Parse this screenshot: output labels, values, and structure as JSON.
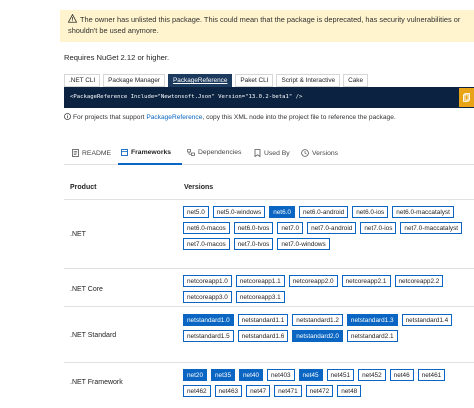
{
  "warning": {
    "text": "The owner has unlisted this package. This could mean that the package is deprecated, has security vulnerabilities or shouldn't be used anymore."
  },
  "requires": "Requires NuGet 2.12 or higher.",
  "install_tabs": [
    {
      "label": ".NET CLI",
      "active": false
    },
    {
      "label": "Package Manager",
      "active": false
    },
    {
      "label": "PackageReference",
      "active": true
    },
    {
      "label": "Paket CLI",
      "active": false
    },
    {
      "label": "Script & Interactive",
      "active": false
    },
    {
      "label": "Cake",
      "active": false
    }
  ],
  "code": "<PackageReference Include=\"Newtonsoft.Json\" Version=\"13.0.2-beta1\" />",
  "info": {
    "prefix": "For projects that support ",
    "link": "PackageReference",
    "suffix": ", copy this XML node into the project file to reference the package."
  },
  "sub_tabs": [
    {
      "label": "README",
      "icon": "document-icon"
    },
    {
      "label": "Frameworks",
      "icon": "frameworks-icon"
    },
    {
      "label": "Dependencies",
      "icon": "dependencies-icon"
    },
    {
      "label": "Used By",
      "icon": "used-by-icon"
    },
    {
      "label": "Versions",
      "icon": "history-icon"
    }
  ],
  "table": {
    "product_header": "Product",
    "versions_header": "Versions",
    "rows": [
      {
        "product": ".NET",
        "versions": [
          {
            "label": "net5.0",
            "on": false
          },
          {
            "label": "net5.0-windows",
            "on": false
          },
          {
            "label": "net6.0",
            "on": true
          },
          {
            "label": "net6.0-android",
            "on": false
          },
          {
            "label": "net6.0-ios",
            "on": false
          },
          {
            "label": "net6.0-maccatalyst",
            "on": false
          },
          {
            "label": "net6.0-macos",
            "on": false
          },
          {
            "label": "net6.0-tvos",
            "on": false
          },
          {
            "label": "net7.0",
            "on": false
          },
          {
            "label": "net7.0-android",
            "on": false
          },
          {
            "label": "net7.0-ios",
            "on": false
          },
          {
            "label": "net7.0-maccatalyst",
            "on": false
          },
          {
            "label": "net7.0-macos",
            "on": false
          },
          {
            "label": "net7.0-tvos",
            "on": false
          },
          {
            "label": "net7.0-windows",
            "on": false
          }
        ]
      },
      {
        "product": ".NET Core",
        "versions": [
          {
            "label": "netcoreapp1.0",
            "on": false
          },
          {
            "label": "netcoreapp1.1",
            "on": false
          },
          {
            "label": "netcoreapp2.0",
            "on": false
          },
          {
            "label": "netcoreapp2.1",
            "on": false
          },
          {
            "label": "netcoreapp2.2",
            "on": false
          },
          {
            "label": "netcoreapp3.0",
            "on": false
          },
          {
            "label": "netcoreapp3.1",
            "on": false
          }
        ]
      },
      {
        "product": ".NET Standard",
        "versions": [
          {
            "label": "netstandard1.0",
            "on": true
          },
          {
            "label": "netstandard1.1",
            "on": false
          },
          {
            "label": "netstandard1.2",
            "on": false
          },
          {
            "label": "netstandard1.3",
            "on": true
          },
          {
            "label": "netstandard1.4",
            "on": false
          },
          {
            "label": "netstandard1.5",
            "on": false
          },
          {
            "label": "netstandard1.6",
            "on": false
          },
          {
            "label": "netstandard2.0",
            "on": true
          },
          {
            "label": "netstandard2.1",
            "on": false
          }
        ]
      },
      {
        "product": ".NET Framework",
        "versions": [
          {
            "label": "net20",
            "on": true
          },
          {
            "label": "net35",
            "on": true
          },
          {
            "label": "net40",
            "on": true
          },
          {
            "label": "net403",
            "on": false
          },
          {
            "label": "net45",
            "on": true
          },
          {
            "label": "net451",
            "on": false
          },
          {
            "label": "net452",
            "on": false
          },
          {
            "label": "net46",
            "on": false
          },
          {
            "label": "net461",
            "on": false
          },
          {
            "label": "net462",
            "on": false
          },
          {
            "label": "net463",
            "on": false
          },
          {
            "label": "net47",
            "on": false
          },
          {
            "label": "net471",
            "on": false
          },
          {
            "label": "net472",
            "on": false
          },
          {
            "label": "net48",
            "on": false
          }
        ]
      }
    ]
  },
  "colors": {
    "accent": "#0a66c2",
    "code_bg": "#0b2341",
    "warning_bg": "#fff4ce",
    "copy_button": "#e8a317"
  }
}
